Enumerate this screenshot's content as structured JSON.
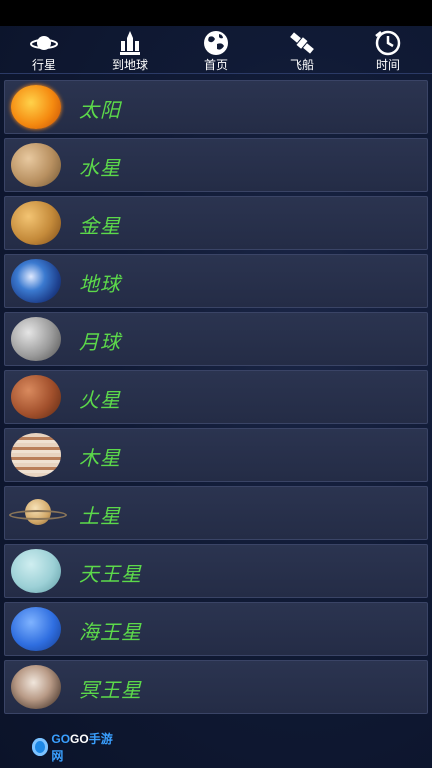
{
  "nav": {
    "items": [
      {
        "label": "行星",
        "icon": "planet-icon"
      },
      {
        "label": "到地球",
        "icon": "rocket-icon"
      },
      {
        "label": "首页",
        "icon": "globe-icon"
      },
      {
        "label": "飞船",
        "icon": "satellite-icon"
      },
      {
        "label": "时间",
        "icon": "clock-icon"
      }
    ]
  },
  "planets": [
    {
      "name": "太阳"
    },
    {
      "name": "水星"
    },
    {
      "name": "金星"
    },
    {
      "name": "地球"
    },
    {
      "name": "月球"
    },
    {
      "name": "火星"
    },
    {
      "name": "木星"
    },
    {
      "name": "土星"
    },
    {
      "name": "天王星"
    },
    {
      "name": "海王星"
    },
    {
      "name": "冥王星"
    }
  ],
  "footer": {
    "logo_go1": "GO",
    "logo_go2": "GO",
    "logo_suffix": "手游网"
  },
  "colors": {
    "planet_name": "#5cd94a",
    "row_bg": "#2b3450",
    "background": "#101a35"
  }
}
